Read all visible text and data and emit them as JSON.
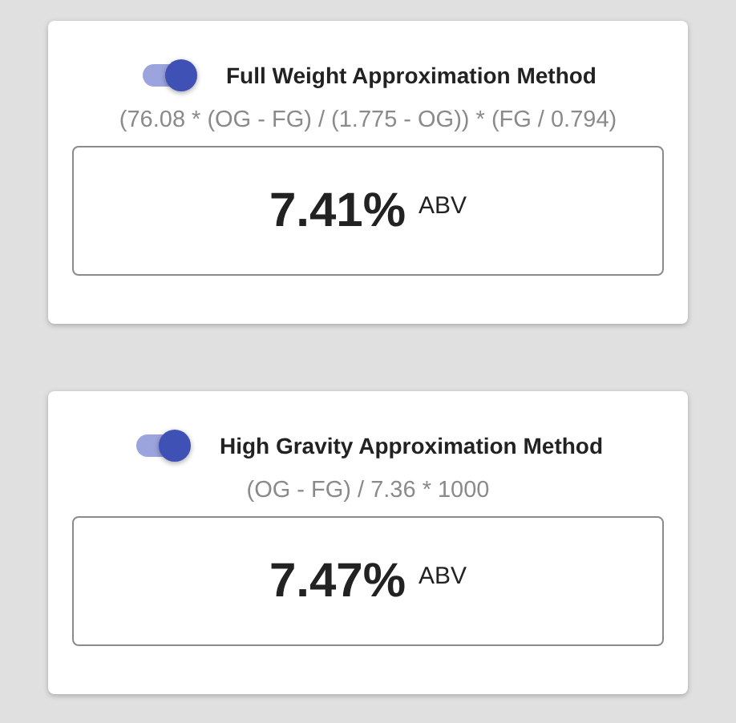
{
  "methods": [
    {
      "title": "Full Weight Approximation Method",
      "on": true,
      "formula": "(76.08 * (OG - FG) / (1.775 - OG)) * (FG / 0.794)",
      "value": "7.41%",
      "unit": "ABV"
    },
    {
      "title": "High Gravity Approximation Method",
      "on": true,
      "formula": "(OG - FG) / 7.36 * 1000",
      "value": "7.47%",
      "unit": "ABV"
    }
  ]
}
